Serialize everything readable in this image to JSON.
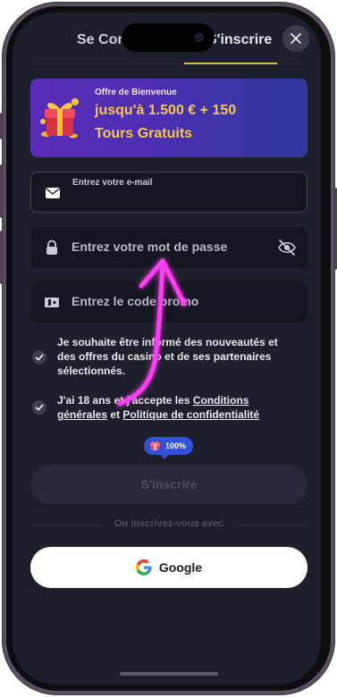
{
  "tabs": {
    "login_label": "Se Connecter",
    "register_label": "S'inscrire"
  },
  "close_icon": "close-icon",
  "banner": {
    "subtitle": "Offre de Bienvenue",
    "line1": "jusqu'à 1.500 € + 150",
    "line2": "Tours Gratuits",
    "icon": "gift-icon"
  },
  "form": {
    "email_label": "Entrez votre e-mail",
    "email_value": "",
    "password_placeholder": "Entrez votre mot de passe",
    "promo_placeholder": "Entrez le code promo",
    "icons": {
      "email": "envelope-icon",
      "password": "lock-icon",
      "promo": "ticket-icon",
      "toggle": "eye-off-icon"
    }
  },
  "consents": {
    "newsletter_text": "Je souhaite être informé des nouveautés et des offres du casino et de ses partenaires sélectionnés.",
    "terms_prefix": "J'ai 18 ans et j'accepte les",
    "terms_link": "Conditions générales",
    "terms_middle": "et",
    "privacy_link": "Politique de confidentialité"
  },
  "progress": {
    "percent_label": "100%",
    "value": 1.0
  },
  "submit_label": "S'inscrire",
  "divider_text": "Ou inscrivez-vous avec",
  "google_label": "Google",
  "colors": {
    "background": "#1d1f2b",
    "accent": "#e8b93a",
    "banner_text": "#f5c84a",
    "annotation_arrow": "#ff3df2"
  }
}
